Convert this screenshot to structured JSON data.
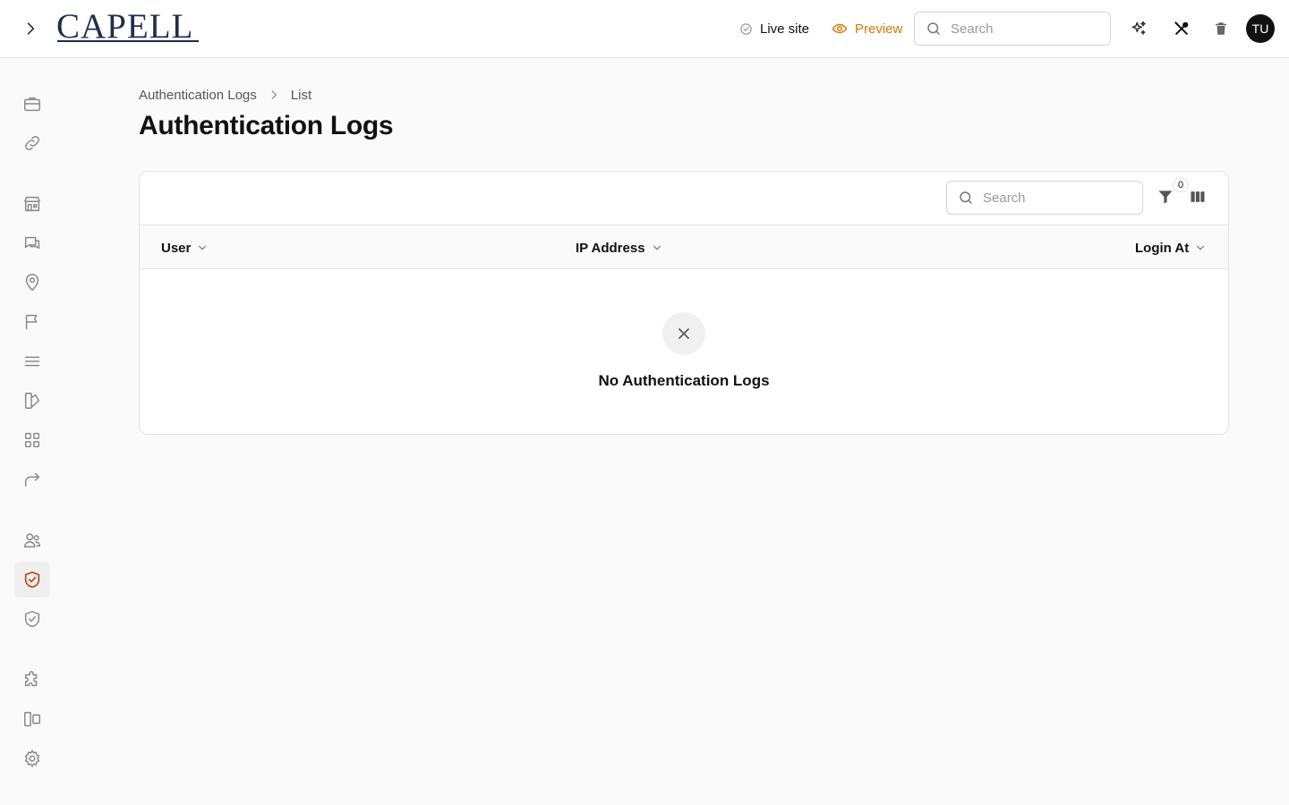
{
  "app": {
    "logo_text": "CAPELL",
    "avatar_initials": "TU"
  },
  "header": {
    "live_site_label": "Live site",
    "preview_label": "Preview",
    "search_placeholder": "Search",
    "colors": {
      "preview": "#d97706",
      "active_nav": "#c2410c"
    }
  },
  "sidebar": {
    "items": [
      {
        "icon": "briefcase-icon"
      },
      {
        "icon": "link-icon"
      },
      {
        "icon": "store-icon"
      },
      {
        "icon": "chat-icon"
      },
      {
        "icon": "map-pin-icon"
      },
      {
        "icon": "flag-icon"
      },
      {
        "icon": "menu-lines-icon"
      },
      {
        "icon": "swatch-icon"
      },
      {
        "icon": "grid-icon"
      },
      {
        "icon": "redirect-icon"
      },
      {
        "icon": "users-icon"
      },
      {
        "icon": "shield-check-icon",
        "active": true
      },
      {
        "icon": "shield-check-icon"
      },
      {
        "icon": "puzzle-icon"
      },
      {
        "icon": "layout-icon"
      },
      {
        "icon": "gear-icon"
      }
    ]
  },
  "main": {
    "breadcrumb": [
      "Authentication Logs",
      "List"
    ],
    "title": "Authentication Logs",
    "table": {
      "search_placeholder": "Search",
      "filter_count": "0",
      "columns": [
        "User",
        "IP Address",
        "Login At"
      ],
      "rows": [],
      "empty_message": "No Authentication Logs"
    }
  }
}
